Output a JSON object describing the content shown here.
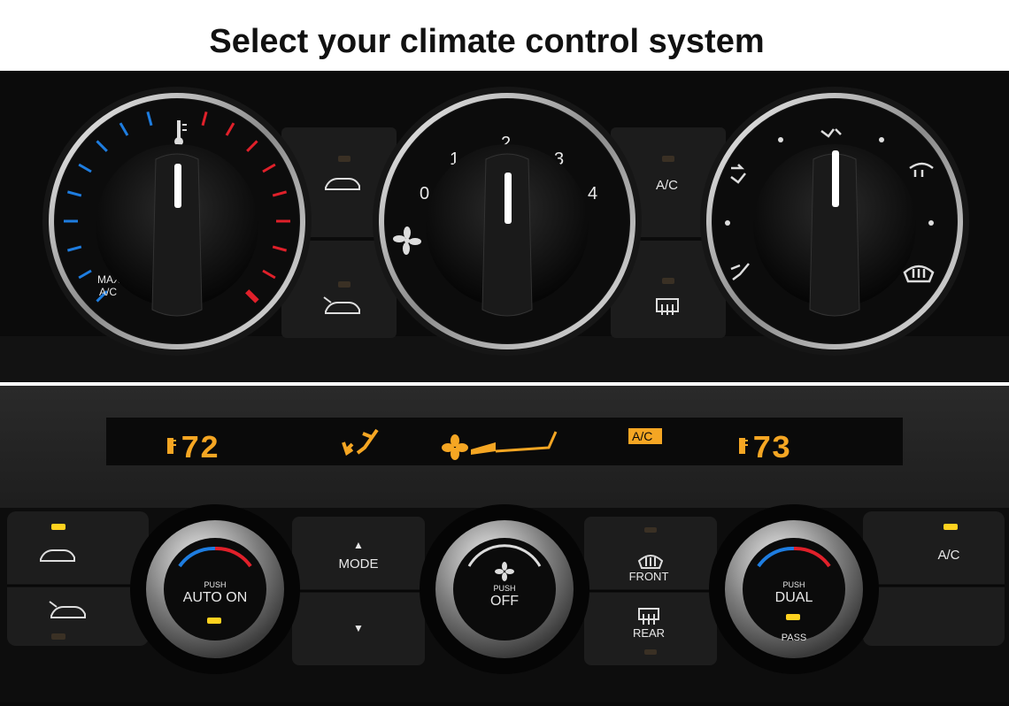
{
  "title": "Select your climate control system",
  "manual": {
    "temp_dial": {
      "max_label_1": "MAX",
      "max_label_2": "A/C"
    },
    "fan_dial": {
      "speeds": [
        "0",
        "1",
        "2",
        "3",
        "4"
      ]
    },
    "ac_label": "A/C",
    "icons": [
      "thermometer-icon",
      "fan-icon",
      "recirculate-icon",
      "fresh-air-icon",
      "rear-defrost-icon",
      "vent-face-icon",
      "vent-face-feet-icon",
      "vent-feet-icon",
      "windshield-defrost-icon"
    ]
  },
  "auto": {
    "display": {
      "left_temp": "72",
      "right_temp": "73",
      "ac_badge": "A/C"
    },
    "left_knob": {
      "push": "PUSH",
      "label": "AUTO ON"
    },
    "mode": {
      "label": "MODE",
      "up": "▲",
      "down": "▼"
    },
    "center_knob": {
      "push": "PUSH",
      "label": "OFF"
    },
    "front_label": "FRONT",
    "rear_label": "REAR",
    "right_knob": {
      "push": "PUSH",
      "label": "DUAL",
      "sub": "PASS"
    },
    "ac_label": "A/C"
  },
  "colors": {
    "lcd": "#f5a623",
    "indicator": "#ffd21f",
    "cold": "#1e7de0",
    "hot": "#e0202a"
  }
}
